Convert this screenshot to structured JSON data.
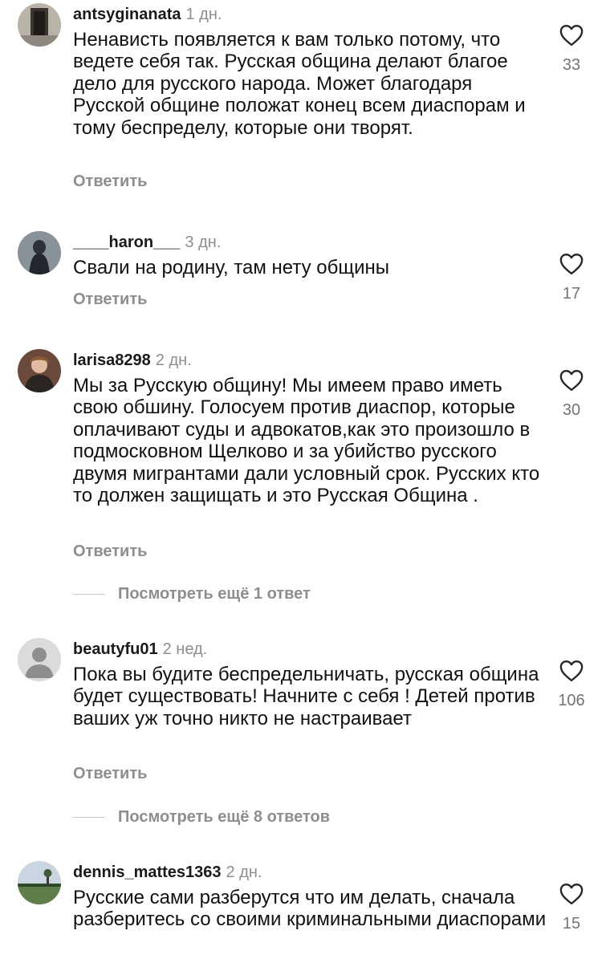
{
  "comments": [
    {
      "username": "antsyginanata",
      "time": "1 дн.",
      "text": "Ненависть появляется к вам только потому, что ведете себя так. Русская община делают благое дело для русского народа. Может благодаря Русской общине положат конец всем диаспорам и тому беспределу, которые они творят.",
      "reply_label": "Ответить",
      "likes": "33"
    },
    {
      "username": "____haron___",
      "time": "3 дн.",
      "text": "Свали на родину, там нету общины",
      "reply_label": "Ответить",
      "likes": "17"
    },
    {
      "username": "larisa8298",
      "time": "2 дн.",
      "text": "Мы за Русскую общину! Мы имеем право иметь свою обшину. Голосуем против диаспор, которые оплачивают суды и адвокатов,как это произошло в подмосковном Щелково и за убийство русского двумя мигрантами дали условный срок. Русских кто то должен защищать и это Русская Община .",
      "reply_label": "Ответить",
      "likes": "30",
      "view_replies": "Посмотреть ещё 1 ответ"
    },
    {
      "username": "beautyfu01",
      "time": "2 нед.",
      "text": "Пока вы будите беспредельничать, русская община будет существовать! Начните с себя ! Детей против ваших уж точно никто не настраивает",
      "reply_label": "Ответить",
      "likes": "106",
      "view_replies": "Посмотреть ещё 8 ответов"
    },
    {
      "username": "dennis_mattes1363",
      "time": "2 дн.",
      "text": "Русские сами разберутся что им делать, сначала разберитесь со своими криминальными диаспорами",
      "likes": "15"
    }
  ],
  "icons": {
    "like": "heart-outline-icon",
    "default_avatar": "person-silhouette-icon"
  },
  "colors": {
    "text": "#111111",
    "secondary": "#8e8e8e",
    "count": "#737373",
    "background": "#ffffff"
  }
}
